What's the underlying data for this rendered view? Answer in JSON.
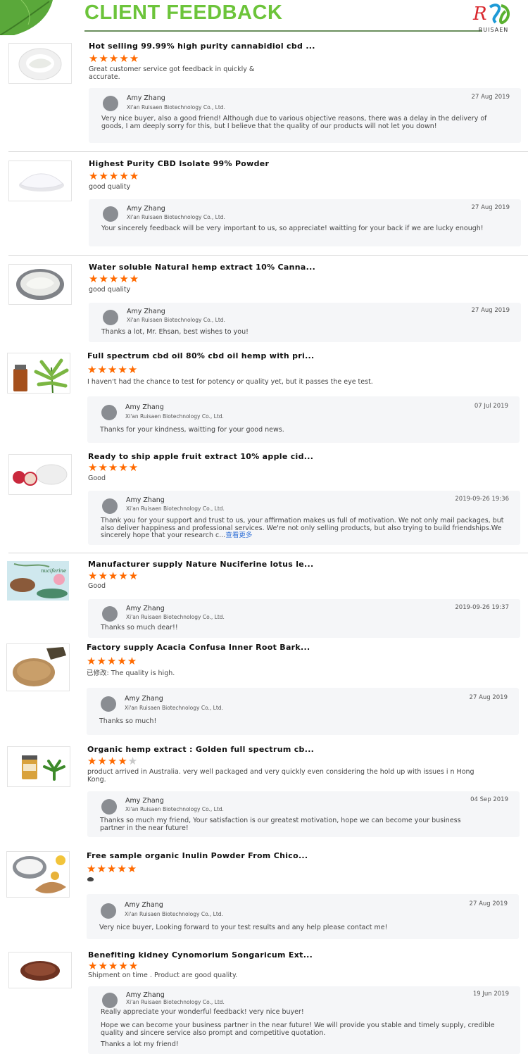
{
  "header": {
    "title": "CLIENT FEEDBACK",
    "logo_text": "RUISAEN"
  },
  "colors": {
    "title_green": "#6cc43a",
    "star_orange": "#ff6a00",
    "link_blue": "#2f6fd6"
  },
  "items": [
    {
      "title": "Hot selling 99.99% high purity cannabidiol cbd ...",
      "rating": 5,
      "comment": "Great customer service got feedback in quickly & accurate.",
      "reply": {
        "name": "Amy Zhang",
        "company": "Xi'an Ruisaen Biotechnology Co., Ltd.",
        "date": "27 Aug 2019",
        "text": "Very nice buyer, also a good friend! Although due to various objective reasons, there was a delay in the delivery of goods, I am deeply sorry for this, but I believe that the quality of our products will not let you down!"
      }
    },
    {
      "title": "Highest Purity CBD Isolate 99% Powder",
      "rating": 5,
      "comment": "good quality",
      "reply": {
        "name": "Amy Zhang",
        "company": "Xi'an Ruisaen Biotechnology Co., Ltd.",
        "date": "27 Aug 2019",
        "text": "Your sincerely feedback will be very important to us, so appreciate! waitting for your back if we are lucky enough!"
      }
    },
    {
      "title": "Water soluble Natural hemp extract 10% Canna...",
      "rating": 5,
      "comment": "good quality",
      "reply": {
        "name": "Amy Zhang",
        "company": "Xi'an Ruisaen Biotechnology Co., Ltd.",
        "date": "27 Aug 2019",
        "text": "Thanks a lot, Mr. Ehsan, best wishes to you!"
      }
    },
    {
      "title": "Full spectrum cbd oil 80% cbd oil hemp with pri...",
      "rating": 5,
      "comment": "I haven't had the chance to test for potency or quality yet, but it passes the eye test.",
      "reply": {
        "name": "Amy Zhang",
        "company": "Xi'an Ruisaen Biotechnology Co., Ltd.",
        "date": "07 Jul 2019",
        "text": "Thanks for your kindness, waitting for your good news."
      }
    },
    {
      "title": "Ready to ship apple fruit extract 10% apple cid...",
      "rating": 5,
      "comment": "Good",
      "reply": {
        "name": "Amy Zhang",
        "company": "Xi'an Ruisaen Biotechnology Co., Ltd.",
        "date": "2019-09-26 19:36",
        "text": "Thank you for your support and trust to us,  your affirmation makes us full of motivation. We not only mail packages, but also deliver happiness and professional services. We're not only selling products, but also trying to build friendships.We sincerely hope that your research c...",
        "more": "查看更多"
      }
    },
    {
      "title": "Manufacturer supply Nature Nuciferine lotus le...",
      "rating": 5,
      "comment": "Good",
      "thumb_label": "nuciferine",
      "reply": {
        "name": "Amy Zhang",
        "company": "Xi'an Ruisaen Biotechnology Co., Ltd.",
        "date": "2019-09-26 19:37",
        "text": "Thanks so much dear!!"
      }
    },
    {
      "title": "Factory supply Acacia Confusa Inner Root Bark...",
      "rating": 5,
      "comment": "已修改: The quality is high.",
      "reply": {
        "name": "Amy Zhang",
        "company": "Xi'an Ruisaen Biotechnology Co., Ltd.",
        "date": "27 Aug 2019",
        "text": "Thanks so much!"
      }
    },
    {
      "title": "Organic hemp extract : Golden full spectrum cb...",
      "rating": 4,
      "comment": "product arrived in Australia. very well packaged and very quickly even considering the hold up with issues i n Hong Kong.",
      "reply": {
        "name": "Amy Zhang",
        "company": "Xi'an Ruisaen Biotechnology Co., Ltd.",
        "date": "04 Sep 2019",
        "text": "Thanks so much my friend, Your satisfaction is our greatest motivation, hope we can become your business partner in the near future!"
      }
    },
    {
      "title": "Free sample organic Inulin Powder From Chico...",
      "rating": 5,
      "comment": "",
      "reply": {
        "name": "Amy Zhang",
        "company": "Xi'an Ruisaen Biotechnology Co., Ltd.",
        "date": "27 Aug 2019",
        "text": "Very nice buyer, Looking forward to your test results and any help please contact me!"
      }
    },
    {
      "title": "Benefiting kidney Cynomorium Songaricum Ext...",
      "rating": 5,
      "comment": "Shipment on time . Product are good quality.",
      "reply": {
        "name": "Amy Zhang",
        "company": "Xi'an Ruisaen Biotechnology Co., Ltd.",
        "date": "19 Jun 2019",
        "text": "Really appreciate your wonderful feedback! very nice buyer!",
        "text2": "Hope we can become your business partner in the near future! We will provide you stable and timely supply, credible quality and sincere service also prompt and competitive quotation.",
        "text3": "Thanks a lot my friend!"
      }
    }
  ]
}
